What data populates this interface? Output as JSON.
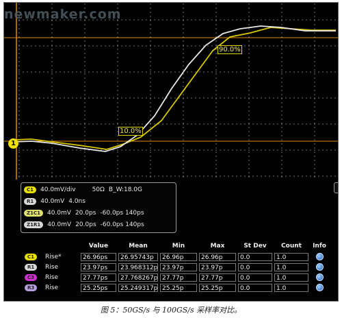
{
  "watermark": "newmaker.com",
  "channel_marker": "1",
  "ref_levels": {
    "high": "90.0%",
    "low": "10.0%"
  },
  "colors": {
    "c1_white": "#e8e8e8",
    "r1_yellow": "#e0d000",
    "grid": "#c6c6c6",
    "ref_line": "#e08a00",
    "c1_badge": "#e8e000",
    "r1_badge": "#d8d8d8",
    "z_badge": "#e0e070"
  },
  "controls": [
    {
      "badge": "C1",
      "text": "40.0mV/div",
      "extra1": "50Ω",
      "extra2": "B_W:18.0G"
    },
    {
      "badge": "R1",
      "text": "40.0mV",
      "extra1": "4.0ns",
      "extra2": ""
    },
    {
      "badge": "Z1C1",
      "text": "40.0mV",
      "extra1": "20.0ps",
      "extra2": "-60.0ps  140ps"
    },
    {
      "badge": "Z1R1",
      "text": "40.0mV",
      "extra1": "20.0ps",
      "extra2": "-60.0ps  140ps"
    }
  ],
  "measurements": {
    "headers": [
      "Value",
      "Mean",
      "Min",
      "Max",
      "St Dev",
      "Count",
      "Info"
    ],
    "rows": [
      {
        "badge": "C1",
        "badge_color": "#e8e000",
        "name": "Rise*",
        "value": "26.96ps",
        "mean": "26.95743p",
        "min": "26.96p",
        "max": "26.96p",
        "stdev": "0.0",
        "count": "1.0",
        "info": "info-icon"
      },
      {
        "badge": "R1",
        "badge_color": "#d8d8d8",
        "name": "Rise",
        "value": "23.97ps",
        "mean": "23.968312p",
        "min": "23.97p",
        "max": "23.97p",
        "stdev": "0.0",
        "count": "1.0",
        "info": "info-icon"
      },
      {
        "badge": "C3",
        "badge_color": "#d030d0",
        "name": "Rise",
        "value": "27.77ps",
        "mean": "27.768267p",
        "min": "27.77p",
        "max": "27.77p",
        "stdev": "0.0",
        "count": "1.0",
        "info": "info-icon"
      },
      {
        "badge": "R3",
        "badge_color": "#b8a0e0",
        "name": "Rise",
        "value": "25.25ps",
        "mean": "25.249317p",
        "min": "25.25p",
        "max": "25.25p",
        "stdev": "0.0",
        "count": "1.0",
        "info": "info-icon"
      }
    ]
  },
  "caption": "图 5：50GS/s 与 100GS/s 采样率对比。"
}
